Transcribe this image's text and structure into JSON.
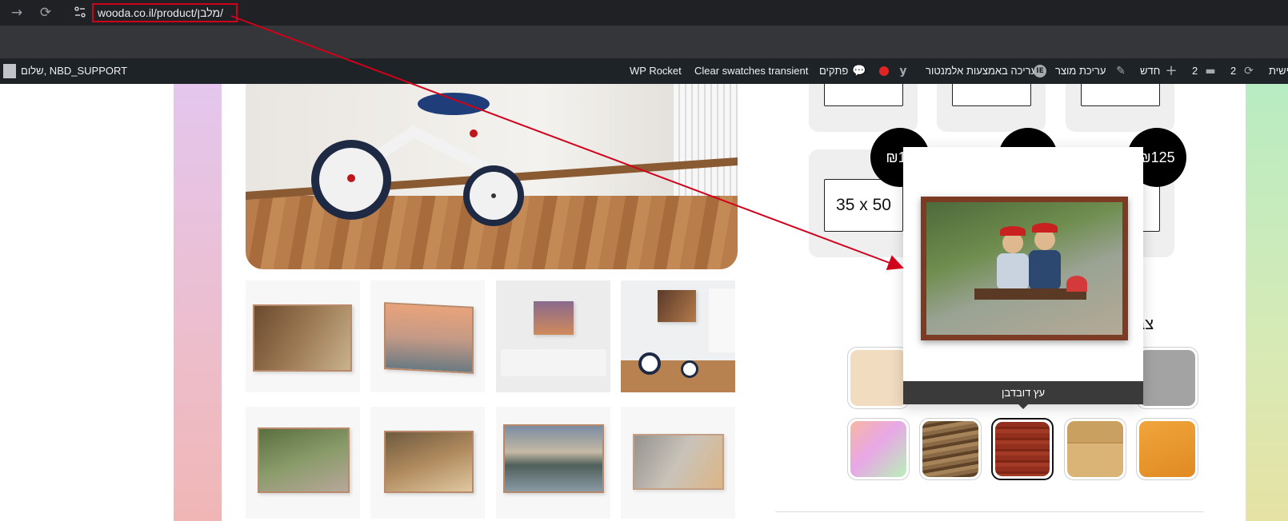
{
  "browser": {
    "url": "wooda.co.il/product/מלבן/",
    "back_icon": "arrow-right-icon",
    "reload_icon": "reload-icon",
    "site_info_icon": "site-info-icon"
  },
  "admin_bar": {
    "greeting": "שלום, NBD_SUPPORT",
    "wp_rocket": "WP Rocket",
    "clear_swatches": "Clear swatches transient",
    "snippets": "פתקים",
    "elementor_edit": "עריכה באמצעות אלמנטור",
    "edit_product": "עריכת מוצר",
    "new": "חדש",
    "comments_count": "2",
    "updates_count": "2",
    "site_name_fragment": "ישית"
  },
  "product_options": {
    "sizes": [
      {
        "label": "35 x 50",
        "price": "₪18"
      },
      {
        "label": "",
        "price": ""
      },
      {
        "label": "",
        "price": "₪125"
      }
    ],
    "color_title": "צבע",
    "swatches": [
      {
        "name": "rainbow-gradient",
        "color": "#f3a6c8",
        "selected": false
      },
      {
        "name": "walnut",
        "color": "#7a5a3a",
        "selected": false
      },
      {
        "name": "cherry-wood",
        "color": "#8e2f1f",
        "selected": true
      },
      {
        "name": "light-oak",
        "color": "#c39a5a",
        "selected": false
      },
      {
        "name": "orange",
        "color": "#e89a30",
        "selected": false
      }
    ],
    "top_swatches": [
      {
        "name": "beige",
        "color": "#f1dcc0"
      },
      {
        "name": "gray",
        "color": "#a3a3a3"
      }
    ]
  },
  "popup": {
    "caption": "עץ דובדבן"
  },
  "colors": {
    "annotation": "#d0021b",
    "admin_bar": "#1d2327",
    "chrome": "#202124"
  }
}
